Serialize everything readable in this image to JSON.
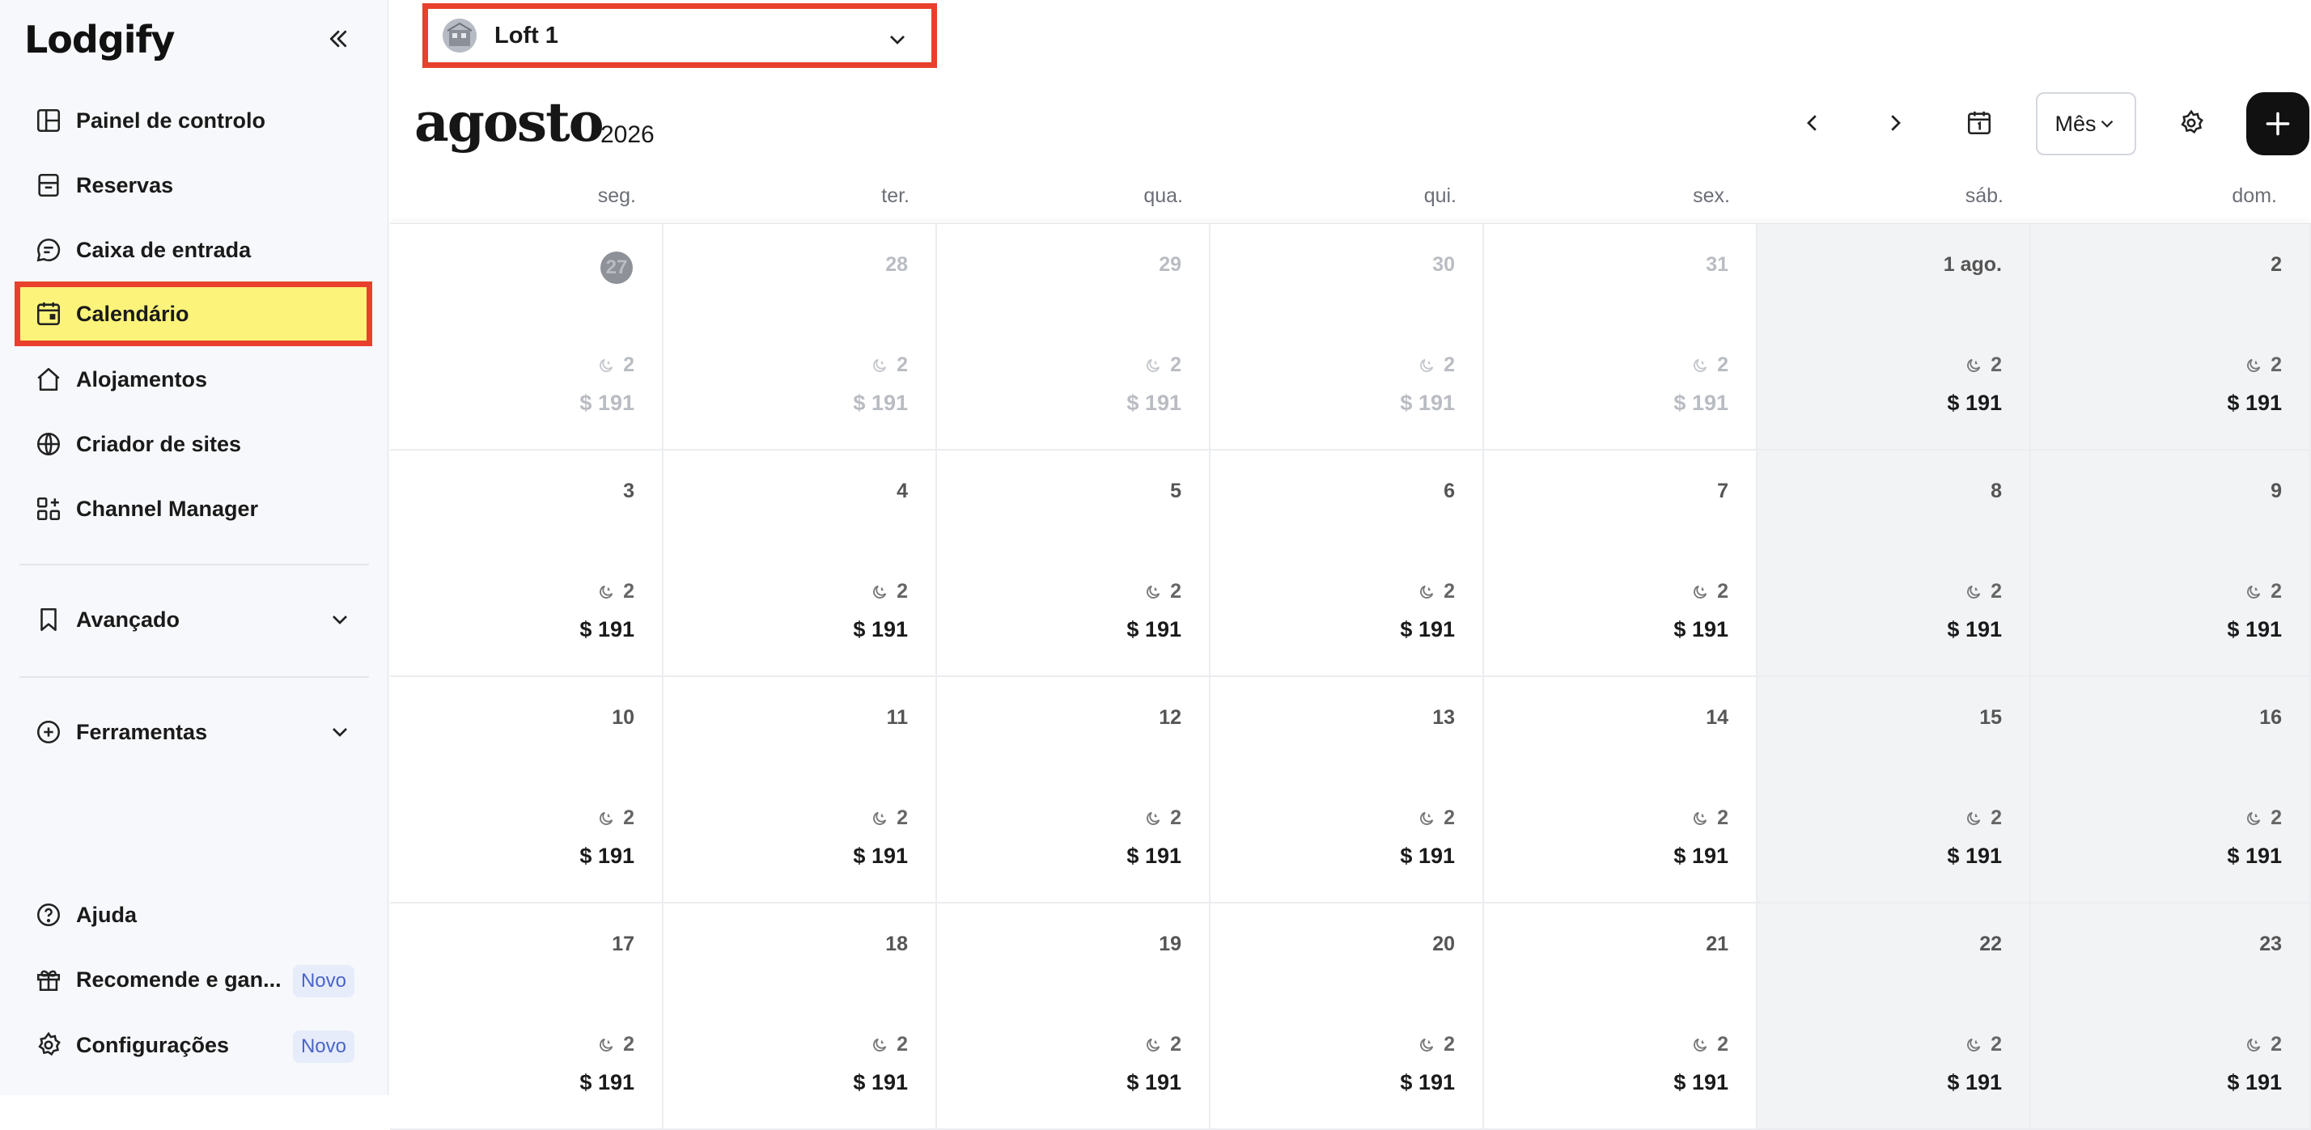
{
  "sidebar": {
    "logo": "Lodgify",
    "nav": [
      {
        "label": "Painel de controlo",
        "icon": "dashboard-icon"
      },
      {
        "label": "Reservas",
        "icon": "bookings-icon"
      },
      {
        "label": "Caixa de entrada",
        "icon": "chat-icon"
      },
      {
        "label": "Calendário",
        "icon": "calendar-icon",
        "active": true
      },
      {
        "label": "Alojamentos",
        "icon": "home-icon"
      },
      {
        "label": "Criador de sites",
        "icon": "globe-icon"
      },
      {
        "label": "Channel Manager",
        "icon": "grid-plus-icon"
      }
    ],
    "sections": [
      {
        "label": "Avançado",
        "icon": "bookmark-icon"
      },
      {
        "label": "Ferramentas",
        "icon": "plus-circle-icon"
      }
    ],
    "bottom": [
      {
        "label": "Ajuda",
        "icon": "help-icon"
      },
      {
        "label": "Recomende e gan...",
        "icon": "gift-icon",
        "badge": "Novo"
      },
      {
        "label": "Configurações",
        "icon": "gear-icon",
        "badge": "Novo"
      }
    ]
  },
  "header": {
    "property": "Loft 1",
    "month": "agosto",
    "year": "2026",
    "view": "Mês"
  },
  "calendar": {
    "weekdays": [
      "seg.",
      "ter.",
      "qua.",
      "qui.",
      "sex.",
      "sáb.",
      "dom."
    ],
    "weeks": [
      [
        {
          "day": "27",
          "past": true,
          "today": true,
          "stay": "2",
          "price": "$ 191"
        },
        {
          "day": "28",
          "past": true,
          "stay": "2",
          "price": "$ 191"
        },
        {
          "day": "29",
          "past": true,
          "stay": "2",
          "price": "$ 191"
        },
        {
          "day": "30",
          "past": true,
          "stay": "2",
          "price": "$ 191"
        },
        {
          "day": "31",
          "past": true,
          "stay": "2",
          "price": "$ 191"
        },
        {
          "day": "1 ago.",
          "past": true,
          "stay": "2",
          "price": "$ 191"
        },
        {
          "day": "2",
          "past": true,
          "stay": "2",
          "price": "$ 191"
        }
      ],
      [
        {
          "day": "3",
          "stay": "2",
          "price": "$ 191"
        },
        {
          "day": "4",
          "stay": "2",
          "price": "$ 191"
        },
        {
          "day": "5",
          "stay": "2",
          "price": "$ 191"
        },
        {
          "day": "6",
          "stay": "2",
          "price": "$ 191"
        },
        {
          "day": "7",
          "stay": "2",
          "price": "$ 191"
        },
        {
          "day": "8",
          "stay": "2",
          "price": "$ 191"
        },
        {
          "day": "9",
          "stay": "2",
          "price": "$ 191"
        }
      ],
      [
        {
          "day": "10",
          "stay": "2",
          "price": "$ 191"
        },
        {
          "day": "11",
          "stay": "2",
          "price": "$ 191"
        },
        {
          "day": "12",
          "stay": "2",
          "price": "$ 191"
        },
        {
          "day": "13",
          "stay": "2",
          "price": "$ 191"
        },
        {
          "day": "14",
          "stay": "2",
          "price": "$ 191"
        },
        {
          "day": "15",
          "stay": "2",
          "price": "$ 191"
        },
        {
          "day": "16",
          "stay": "2",
          "price": "$ 191"
        }
      ],
      [
        {
          "day": "17",
          "stay": "2",
          "price": "$ 191"
        },
        {
          "day": "18",
          "stay": "2",
          "price": "$ 191"
        },
        {
          "day": "19",
          "stay": "2",
          "price": "$ 191"
        },
        {
          "day": "20",
          "stay": "2",
          "price": "$ 191"
        },
        {
          "day": "21",
          "stay": "2",
          "price": "$ 191"
        },
        {
          "day": "22",
          "stay": "2",
          "price": "$ 191"
        },
        {
          "day": "23",
          "stay": "2",
          "price": "$ 191"
        }
      ]
    ]
  }
}
